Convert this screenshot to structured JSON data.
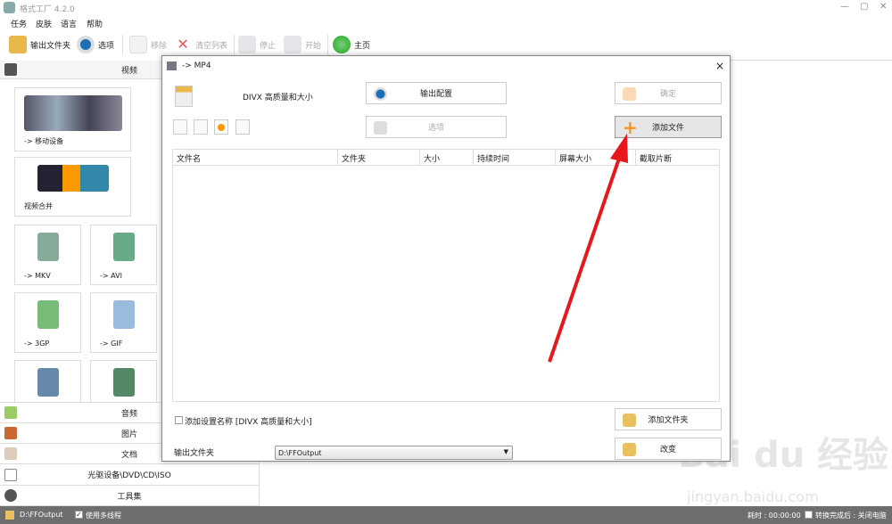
{
  "app": {
    "title": "格式工厂 4.2.0",
    "window_controls": [
      "—",
      "▢",
      "✕"
    ]
  },
  "menu": [
    "任务",
    "皮肤",
    "语言",
    "帮助"
  ],
  "toolbar": {
    "output_folder": "输出文件夹",
    "options": "选项",
    "remove": "移除",
    "clear_list": "清空列表",
    "stop": "停止",
    "start": "开始",
    "home": "主页"
  },
  "left": {
    "video_header": "视频",
    "tiles": [
      "-> 移动设备",
      "视频合并",
      "-> MKV",
      "-> AVI",
      "-> 3GP",
      "-> GIF"
    ],
    "categories": [
      "音频",
      "图片",
      "文档",
      "光驱设备\\DVD\\CD\\ISO",
      "工具集"
    ]
  },
  "dialog": {
    "title": "-> MP4",
    "profile": "DIVX 高质量和大小",
    "output_config": "输出配置",
    "ok": "确定",
    "options": "选项",
    "add_file": "添加文件",
    "columns": [
      "文件名",
      "文件夹",
      "大小",
      "持续时间",
      "屏幕大小",
      "截取片断"
    ],
    "add_setting_name": "添加设置名称 [DIVX 高质量和大小]",
    "add_folder": "添加文件夹",
    "output_folder_label": "输出文件夹",
    "output_folder_value": "D:\\FFOutput",
    "change": "改变",
    "close": "×"
  },
  "status": {
    "path": "D:\\FFOutput",
    "multithread": "使用多线程",
    "elapsed": "耗时 : 00:00:00",
    "after": "转换完成后 : 关闭电脑"
  },
  "watermark": "Baidu经验 jingyan.baidu.com"
}
